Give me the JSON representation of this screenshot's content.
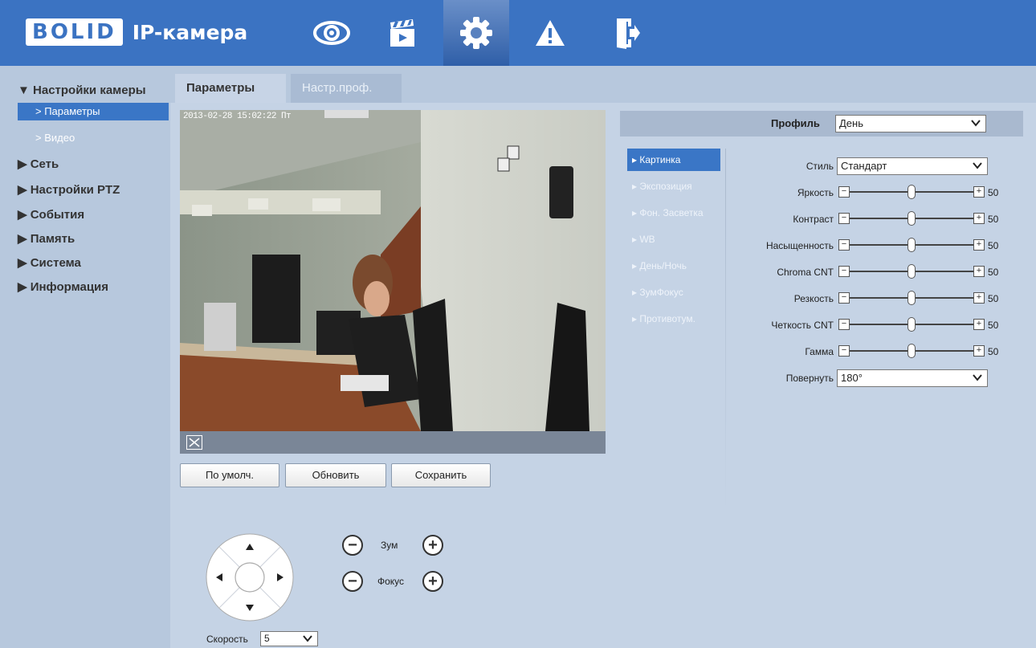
{
  "header": {
    "logo_text": "BOLID",
    "product": "IP-камера",
    "nav": [
      {
        "name": "live-view",
        "icon": "eye-icon"
      },
      {
        "name": "playback",
        "icon": "clapperboard-icon"
      },
      {
        "name": "settings",
        "icon": "gear-icon",
        "active": true
      },
      {
        "name": "alarm",
        "icon": "warning-icon"
      },
      {
        "name": "logout",
        "icon": "exit-icon"
      }
    ]
  },
  "sidebar": {
    "camera_settings": "▼ Настройки камеры",
    "sub_params": "> Параметры",
    "sub_video": "> Видео",
    "network": "▶ Сеть",
    "ptz": "▶ Настройки PTZ",
    "events": "▶ События",
    "storage": "▶ Память",
    "system": "▶ Система",
    "info": "▶ Информация"
  },
  "tabs": {
    "params": "Параметры",
    "profile_setup": "Настр.проф."
  },
  "video": {
    "osd_text": "2013-02-28 15:02:22 Пт"
  },
  "buttons": {
    "default": "По умолч.",
    "refresh": "Обновить",
    "save": "Сохранить"
  },
  "ptz": {
    "zoom_label": "Зум",
    "focus_label": "Фокус",
    "speed_label": "Скорость",
    "speed_value": "5"
  },
  "profile": {
    "label": "Профиль",
    "value": "День"
  },
  "submenu": {
    "picture": "▸ Картинка",
    "exposure": "▸ Экспозиция",
    "backlight": "▸ Фон. Засветка",
    "wb": "▸ WB",
    "daynight": "▸ День/Ночь",
    "zoomfocus": "▸ ЗумФокус",
    "defog": "▸ Противотум."
  },
  "picture": {
    "style_label": "Стиль",
    "style_value": "Стандарт",
    "sliders": {
      "brightness": {
        "label": "Яркость",
        "value": 50
      },
      "contrast": {
        "label": "Контраст",
        "value": 50
      },
      "saturation": {
        "label": "Насыщенность",
        "value": 50
      },
      "chroma": {
        "label": "Chroma CNT",
        "value": 50
      },
      "sharpness": {
        "label": "Резкость",
        "value": 50
      },
      "sharp_cnt": {
        "label": "Четкость CNT",
        "value": 50
      },
      "gamma": {
        "label": "Гамма",
        "value": 50
      }
    },
    "rotate_label": "Повернуть",
    "rotate_value": "180°"
  },
  "colors": {
    "header_bg": "#3b73c2",
    "page_bg": "#b7c8dd",
    "accent": "#3a76c6"
  }
}
